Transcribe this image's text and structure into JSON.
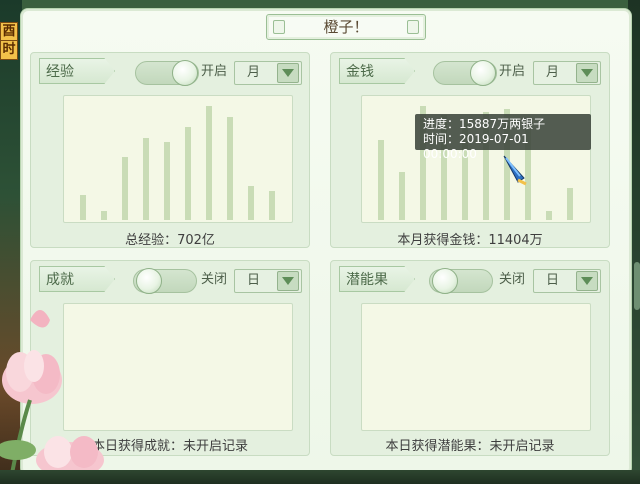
{
  "title": "橙子！",
  "side_tags": [
    "酉",
    "时"
  ],
  "panels": {
    "exp": {
      "label": "经验",
      "toggle_state": "开启",
      "period": "月",
      "caption": "总经验：702亿",
      "chart_values": [
        0.22,
        0.08,
        0.55,
        0.72,
        0.68,
        0.82,
        1.0,
        0.9,
        0.3,
        0.25
      ]
    },
    "money": {
      "label": "金钱",
      "toggle_state": "开启",
      "period": "月",
      "caption": "本月获得金钱：11404万",
      "chart_values": [
        0.7,
        0.42,
        1.0,
        0.92,
        0.88,
        0.95,
        0.97,
        0.85,
        0.08,
        0.28
      ]
    },
    "achievement": {
      "label": "成就",
      "toggle_state": "关闭",
      "period": "日",
      "caption": "本日获得成就：未开启记录"
    },
    "potential": {
      "label": "潜能果",
      "toggle_state": "关闭",
      "period": "日",
      "caption": "本日获得潜能果：未开启记录"
    }
  },
  "tooltip": {
    "progress": "进度：15887万两银子",
    "time": "时间：2019-07-01 00:00:00"
  },
  "colors": {
    "panel_bg": "#e4f0df",
    "chart_bg": "#f4f8e6",
    "bar": "#c9dcb6"
  }
}
